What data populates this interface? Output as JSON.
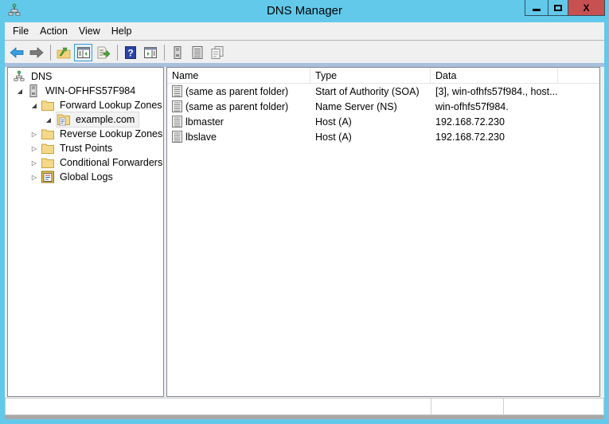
{
  "window": {
    "title": "DNS Manager",
    "app_icon": "dns-network-icon",
    "controls": {
      "minimize": "minimize",
      "maximize": "maximize",
      "close": "X"
    }
  },
  "menubar": {
    "items": [
      {
        "label": "File"
      },
      {
        "label": "Action"
      },
      {
        "label": "View"
      },
      {
        "label": "Help"
      }
    ]
  },
  "toolbar": {
    "buttons": [
      {
        "icon": "back-arrow-icon",
        "tooltip": "Back"
      },
      {
        "icon": "forward-arrow-icon",
        "tooltip": "Forward"
      },
      {
        "icon": "up-folder-icon",
        "tooltip": "Up one level"
      },
      {
        "icon": "show-hide-tree-icon",
        "tooltip": "Show/Hide Console Tree",
        "active": true
      },
      {
        "icon": "export-list-icon",
        "tooltip": "Export List"
      },
      {
        "icon": "help-icon",
        "tooltip": "Help"
      },
      {
        "icon": "show-hide-action-pane-icon",
        "tooltip": "Show/Hide Action Pane"
      },
      {
        "icon": "server-icon",
        "tooltip": "Server"
      },
      {
        "icon": "record-list-icon",
        "tooltip": "List"
      },
      {
        "icon": "copy-records-icon",
        "tooltip": "Copy"
      }
    ]
  },
  "tree": {
    "items": [
      {
        "label": "DNS",
        "level": 0,
        "icon": "dns-network-icon",
        "expander": "none"
      },
      {
        "label": "WIN-OFHFS57F984",
        "level": 1,
        "icon": "server-icon",
        "expander": "expanded"
      },
      {
        "label": "Forward Lookup Zones",
        "level": 2,
        "icon": "folder-icon",
        "expander": "expanded"
      },
      {
        "label": "example.com",
        "level": 3,
        "icon": "zone-icon",
        "expander": "expanded",
        "selected": true
      },
      {
        "label": "Reverse Lookup Zones",
        "level": 2,
        "icon": "folder-icon",
        "expander": "collapsed"
      },
      {
        "label": "Trust Points",
        "level": 2,
        "icon": "folder-icon",
        "expander": "collapsed"
      },
      {
        "label": "Conditional Forwarders",
        "level": 2,
        "icon": "folder-icon",
        "expander": "collapsed"
      },
      {
        "label": "Global Logs",
        "level": 2,
        "icon": "event-log-icon",
        "expander": "collapsed"
      }
    ]
  },
  "list": {
    "columns": [
      {
        "label": "Name"
      },
      {
        "label": "Type"
      },
      {
        "label": "Data"
      },
      {
        "label": ""
      }
    ],
    "rows": [
      {
        "name": "(same as parent folder)",
        "type": "Start of Authority (SOA)",
        "data": "[3], win-ofhfs57f984., host..."
      },
      {
        "name": "(same as parent folder)",
        "type": "Name Server (NS)",
        "data": "win-ofhfs57f984."
      },
      {
        "name": "lbmaster",
        "type": "Host (A)",
        "data": "192.168.72.230"
      },
      {
        "name": "lbslave",
        "type": "Host (A)",
        "data": "192.168.72.230"
      }
    ]
  },
  "statusbar": {
    "segments": [
      "",
      "",
      ""
    ]
  },
  "colors": {
    "window_frame": "#62c9ea",
    "close_button": "#c75050",
    "chrome_bg": "#f0f0f0",
    "pane_border": "#828790",
    "toolbar_active": "#3399dd"
  }
}
